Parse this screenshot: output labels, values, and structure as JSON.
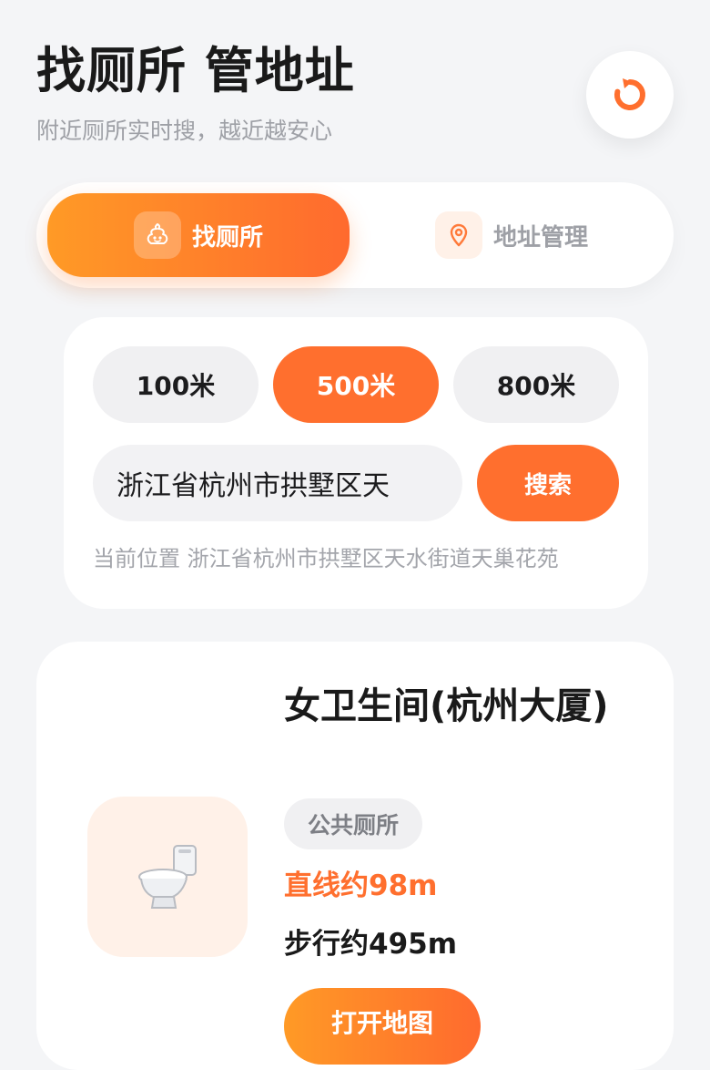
{
  "header": {
    "title": "找厕所 管地址",
    "subtitle": "附近厕所实时搜，越近越安心",
    "refresh_icon": "refresh-icon"
  },
  "tabs": [
    {
      "label": "找厕所",
      "icon": "poop-icon",
      "active": true
    },
    {
      "label": "地址管理",
      "icon": "location-pin-icon",
      "active": false
    }
  ],
  "filter": {
    "radius_options": [
      "100米",
      "500米",
      "800米"
    ],
    "selected_radius": "500米",
    "search_value": "浙江省杭州市拱墅区天",
    "search_button_label": "搜索",
    "current_location_label": "当前位置",
    "current_location_value": "浙江省杭州市拱墅区天水街道天巢花苑"
  },
  "results": [
    {
      "name": "女卫生间(杭州大厦)",
      "category": "公共厕所",
      "straight_distance": "直线约98m",
      "walking_distance": "步行约495m",
      "map_button_label": "打开地图",
      "icon": "toilet-icon"
    }
  ],
  "colors": {
    "accent": "#ff6f2e",
    "accent_light": "#ff9a26",
    "background": "#f4f5f7",
    "muted_text": "#9ea0a6"
  }
}
